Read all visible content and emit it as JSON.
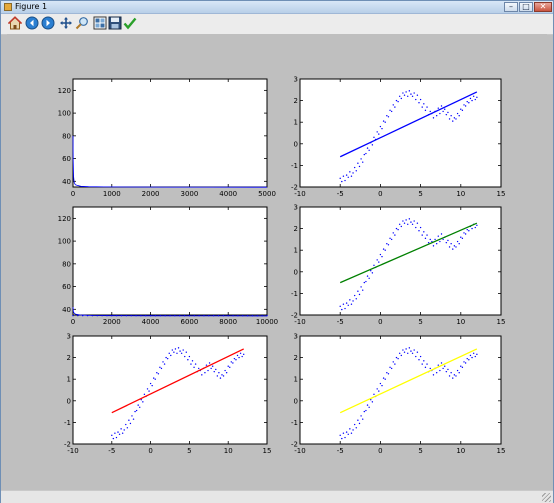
{
  "window": {
    "title": "Figure 1"
  },
  "toolbar": {
    "buttons": [
      {
        "name": "home-icon",
        "label": "Home"
      },
      {
        "name": "back-icon",
        "label": "Back"
      },
      {
        "name": "forward-icon",
        "label": "Forward"
      },
      {
        "name": "pan-icon",
        "label": "Pan"
      },
      {
        "name": "zoom-icon",
        "label": "Zoom"
      },
      {
        "name": "configure-subplots-icon",
        "label": "Configure subplots"
      },
      {
        "name": "save-icon",
        "label": "Save"
      },
      {
        "name": "edit-icon",
        "label": "Edit"
      }
    ]
  },
  "colors": {
    "scatter": "#0000ff",
    "loss": "#0000ff",
    "fit_blue": "#0000ff",
    "fit_green": "#008000",
    "fit_red": "#ff0000",
    "fit_yellow": "#ffff00"
  },
  "chart_data": [
    {
      "type": "line",
      "id": "loss1",
      "xlim": [
        0,
        5000
      ],
      "ylim": [
        35,
        130
      ],
      "xticks": [
        0,
        1000,
        2000,
        3000,
        4000,
        5000
      ],
      "yticks": [
        40,
        60,
        80,
        100,
        120
      ],
      "series": [
        {
          "color": "#0000ff",
          "x": [
            0,
            5,
            15,
            30,
            60,
            100,
            200,
            400,
            800,
            1500,
            2500,
            3500,
            5000
          ],
          "y": [
            80,
            58,
            44,
            39,
            37,
            36.5,
            35.6,
            35.3,
            35.1,
            35.0,
            34.9,
            34.9,
            34.8
          ]
        }
      ]
    },
    {
      "type": "scatter",
      "id": "fit_blue",
      "xlim": [
        -10,
        15
      ],
      "ylim": [
        -2,
        3
      ],
      "xticks": [
        -10,
        -5,
        0,
        5,
        10,
        15
      ],
      "yticks": [
        -2,
        -1,
        0,
        1,
        2,
        3
      ],
      "line": {
        "x": [
          -5,
          12
        ],
        "y": [
          -0.6,
          2.4
        ],
        "color": "#0000ff"
      },
      "scatter_color": "#0000ff"
    },
    {
      "type": "line",
      "id": "loss2",
      "xlim": [
        0,
        10000
      ],
      "ylim": [
        35,
        130
      ],
      "xticks": [
        0,
        2000,
        4000,
        6000,
        8000,
        10000
      ],
      "yticks": [
        40,
        60,
        80,
        100,
        120
      ],
      "series": [
        {
          "color": "#0000ff",
          "x": [
            0,
            20,
            60,
            150,
            400,
            1000,
            2000,
            4000,
            6000,
            8000,
            10000
          ],
          "y": [
            42,
            38,
            36.5,
            35.6,
            35.0,
            34.6,
            34.4,
            34.3,
            34.2,
            34.2,
            34.1
          ]
        }
      ]
    },
    {
      "type": "scatter",
      "id": "fit_green",
      "xlim": [
        -10,
        15
      ],
      "ylim": [
        -2,
        3
      ],
      "xticks": [
        -10,
        -5,
        0,
        5,
        10,
        15
      ],
      "yticks": [
        -2,
        -1,
        0,
        1,
        2,
        3
      ],
      "line": {
        "x": [
          -5,
          12
        ],
        "y": [
          -0.5,
          2.25
        ],
        "color": "#008000"
      },
      "scatter_color": "#0000ff"
    },
    {
      "type": "scatter",
      "id": "fit_red",
      "xlim": [
        -10,
        15
      ],
      "ylim": [
        -2,
        3
      ],
      "xticks": [
        -10,
        -5,
        0,
        5,
        10,
        15
      ],
      "yticks": [
        -2,
        -1,
        0,
        1,
        2,
        3
      ],
      "line": {
        "x": [
          -5,
          12
        ],
        "y": [
          -0.55,
          2.4
        ],
        "color": "#ff0000"
      },
      "scatter_color": "#0000ff"
    },
    {
      "type": "scatter",
      "id": "fit_yellow",
      "xlim": [
        -10,
        15
      ],
      "ylim": [
        -2,
        3
      ],
      "xticks": [
        -10,
        -5,
        0,
        5,
        10,
        15
      ],
      "yticks": [
        -2,
        -1,
        0,
        1,
        2,
        3
      ],
      "line": {
        "x": [
          -5,
          12
        ],
        "y": [
          -0.55,
          2.4
        ],
        "color": "#ffff00"
      },
      "scatter_color": "#0000ff"
    }
  ],
  "scatter_points": {
    "x": [
      -5,
      -4.8,
      -4.6,
      -4.4,
      -4.2,
      -4,
      -3.8,
      -3.6,
      -3.4,
      -3.2,
      -3,
      -2.8,
      -2.6,
      -2.4,
      -2.2,
      -2,
      -1.8,
      -1.6,
      -1.4,
      -1.2,
      -1,
      -0.8,
      -0.6,
      -0.4,
      -0.2,
      0,
      0.2,
      0.4,
      0.6,
      0.8,
      1,
      1.2,
      1.4,
      1.6,
      1.8,
      2,
      2.2,
      2.4,
      2.6,
      2.8,
      3,
      3.2,
      3.4,
      3.6,
      3.8,
      4,
      4.2,
      4.4,
      4.6,
      4.8,
      5,
      5.2,
      5.4,
      5.6,
      5.8,
      6,
      6.2,
      6.4,
      6.6,
      6.8,
      7,
      7.2,
      7.4,
      7.6,
      7.8,
      8,
      8.2,
      8.4,
      8.6,
      8.8,
      9,
      9.2,
      9.4,
      9.6,
      9.8,
      10,
      10.2,
      10.4,
      10.6,
      10.8,
      11,
      11.2,
      11.4,
      11.6,
      11.8,
      12
    ],
    "y": [
      -1.6,
      -1.75,
      -1.5,
      -1.7,
      -1.45,
      -1.55,
      -1.3,
      -1.5,
      -1.35,
      -1.1,
      -1.25,
      -0.9,
      -1.05,
      -0.7,
      -0.85,
      -0.5,
      -0.45,
      -0.2,
      -0.3,
      0.05,
      -0.05,
      0.3,
      0.2,
      0.55,
      0.45,
      0.8,
      0.7,
      1.05,
      1.0,
      1.3,
      1.25,
      1.55,
      1.5,
      1.8,
      1.7,
      2.0,
      1.95,
      2.2,
      2.1,
      2.35,
      2.25,
      2.4,
      2.2,
      2.45,
      2.3,
      2.2,
      2.35,
      2.05,
      2.25,
      1.9,
      2.05,
      1.7,
      1.85,
      1.55,
      1.7,
      1.35,
      1.5,
      1.4,
      1.2,
      1.5,
      1.3,
      1.65,
      1.4,
      1.75,
      1.5,
      1.6,
      1.35,
      1.45,
      1.15,
      1.3,
      1.05,
      1.2,
      1.15,
      1.4,
      1.3,
      1.6,
      1.55,
      1.8,
      1.75,
      1.95,
      1.9,
      2.1,
      2.0,
      2.2,
      2.05,
      2.15
    ]
  }
}
